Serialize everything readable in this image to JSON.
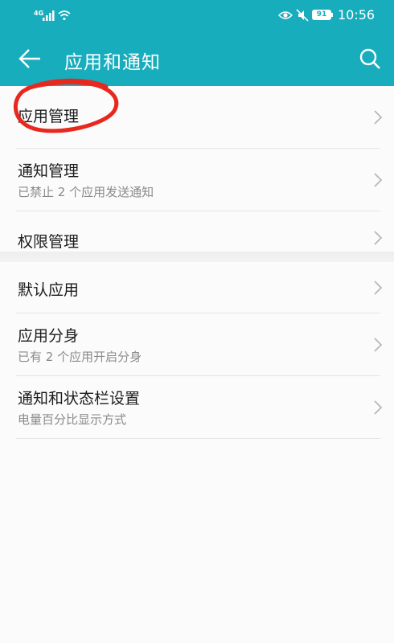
{
  "status_bar": {
    "network": "4G",
    "battery": "91",
    "time": "10:56"
  },
  "header": {
    "title": "应用和通知"
  },
  "groups": [
    {
      "items": [
        {
          "title": "应用管理"
        },
        {
          "title": "通知管理",
          "subtitle": "已禁止 2 个应用发送通知"
        },
        {
          "title": "权限管理"
        }
      ]
    },
    {
      "items": [
        {
          "title": "默认应用"
        },
        {
          "title": "应用分身",
          "subtitle": "已有 2 个应用开启分身"
        },
        {
          "title": "通知和状态栏设置",
          "subtitle": "电量百分比显示方式"
        }
      ]
    }
  ],
  "colors": {
    "header_bg": "#18adbd",
    "annotation": "#e8281e"
  },
  "icons": {
    "back": "arrow-left-icon",
    "search": "search-icon",
    "chevron": "chevron-right-icon"
  }
}
